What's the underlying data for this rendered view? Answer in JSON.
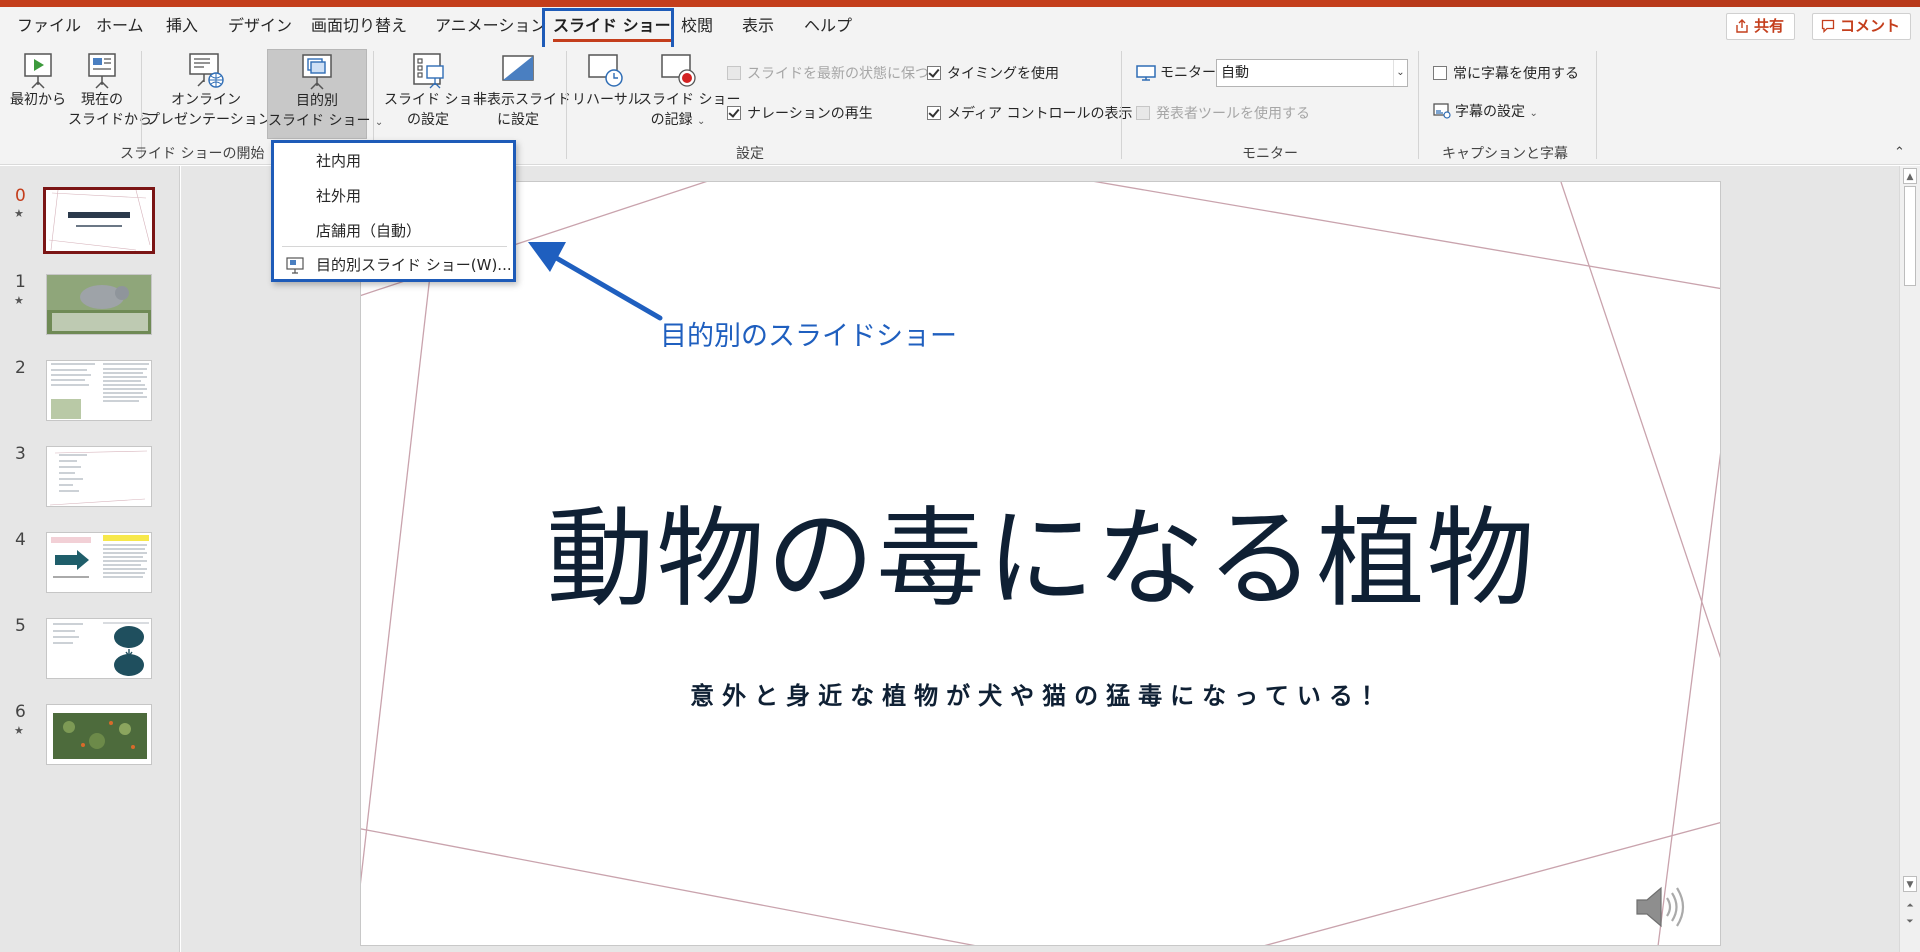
{
  "tabs": [
    "ファイル",
    "ホーム",
    "挿入",
    "デザイン",
    "画面切り替え",
    "アニメーション",
    "スライド ショー",
    "校閲",
    "表示",
    "ヘルプ"
  ],
  "active_tab": "スライド ショー",
  "top_right": {
    "share": "共有",
    "comment": "コメント"
  },
  "ribbon": {
    "start": {
      "from_beginning": "最初から",
      "from_current_1": "現在の",
      "from_current_2": "スライドから",
      "online_1": "オンライン",
      "online_2": "プレゼンテーション",
      "custom_1": "目的別",
      "custom_2": "スライド ショー",
      "group_label": "スライド ショーの開始"
    },
    "setup": {
      "setup_1": "スライド ショー",
      "setup_2": "の設定",
      "hide_1": "非表示スライド",
      "hide_2": "に設定",
      "rehearse": "リハーサル",
      "record_1": "スライド ショー",
      "record_2": "の記録",
      "keep_updated": "スライドを最新の状態に保つ",
      "play_narrations": "ナレーションの再生",
      "use_timings": "タイミングを使用",
      "show_media_controls": "メディア コントロールの表示",
      "group_label": "設定"
    },
    "monitors": {
      "monitor_label": "モニター:",
      "monitor_value": "自動",
      "presenter_view": "発表者ツールを使用する",
      "group_label": "モニター"
    },
    "captions": {
      "always_subtitles": "常に字幕を使用する",
      "subtitle_settings": "字幕の設定",
      "group_label": "キャプションと字幕"
    }
  },
  "dropdown": {
    "items": [
      "社内用",
      "社外用",
      "店舗用（自動）"
    ],
    "custom_shows": "目的別スライド ショー(W)..."
  },
  "callout": "目的別のスライドショー",
  "thumbnails": [
    {
      "num": "0",
      "star": "★"
    },
    {
      "num": "1",
      "star": "★"
    },
    {
      "num": "2",
      "star": ""
    },
    {
      "num": "3",
      "star": ""
    },
    {
      "num": "4",
      "star": ""
    },
    {
      "num": "5",
      "star": ""
    },
    {
      "num": "6",
      "star": "★"
    }
  ],
  "slide": {
    "title": "動物の毒になる植物",
    "subtitle": "意外と身近な植物が犬や猫の猛毒になっている！"
  },
  "colors": {
    "accent": "#c43e1c",
    "highlight": "#1e5bb8",
    "slide_text": "#0f2034",
    "slide_lines": "#c9a3ad"
  }
}
